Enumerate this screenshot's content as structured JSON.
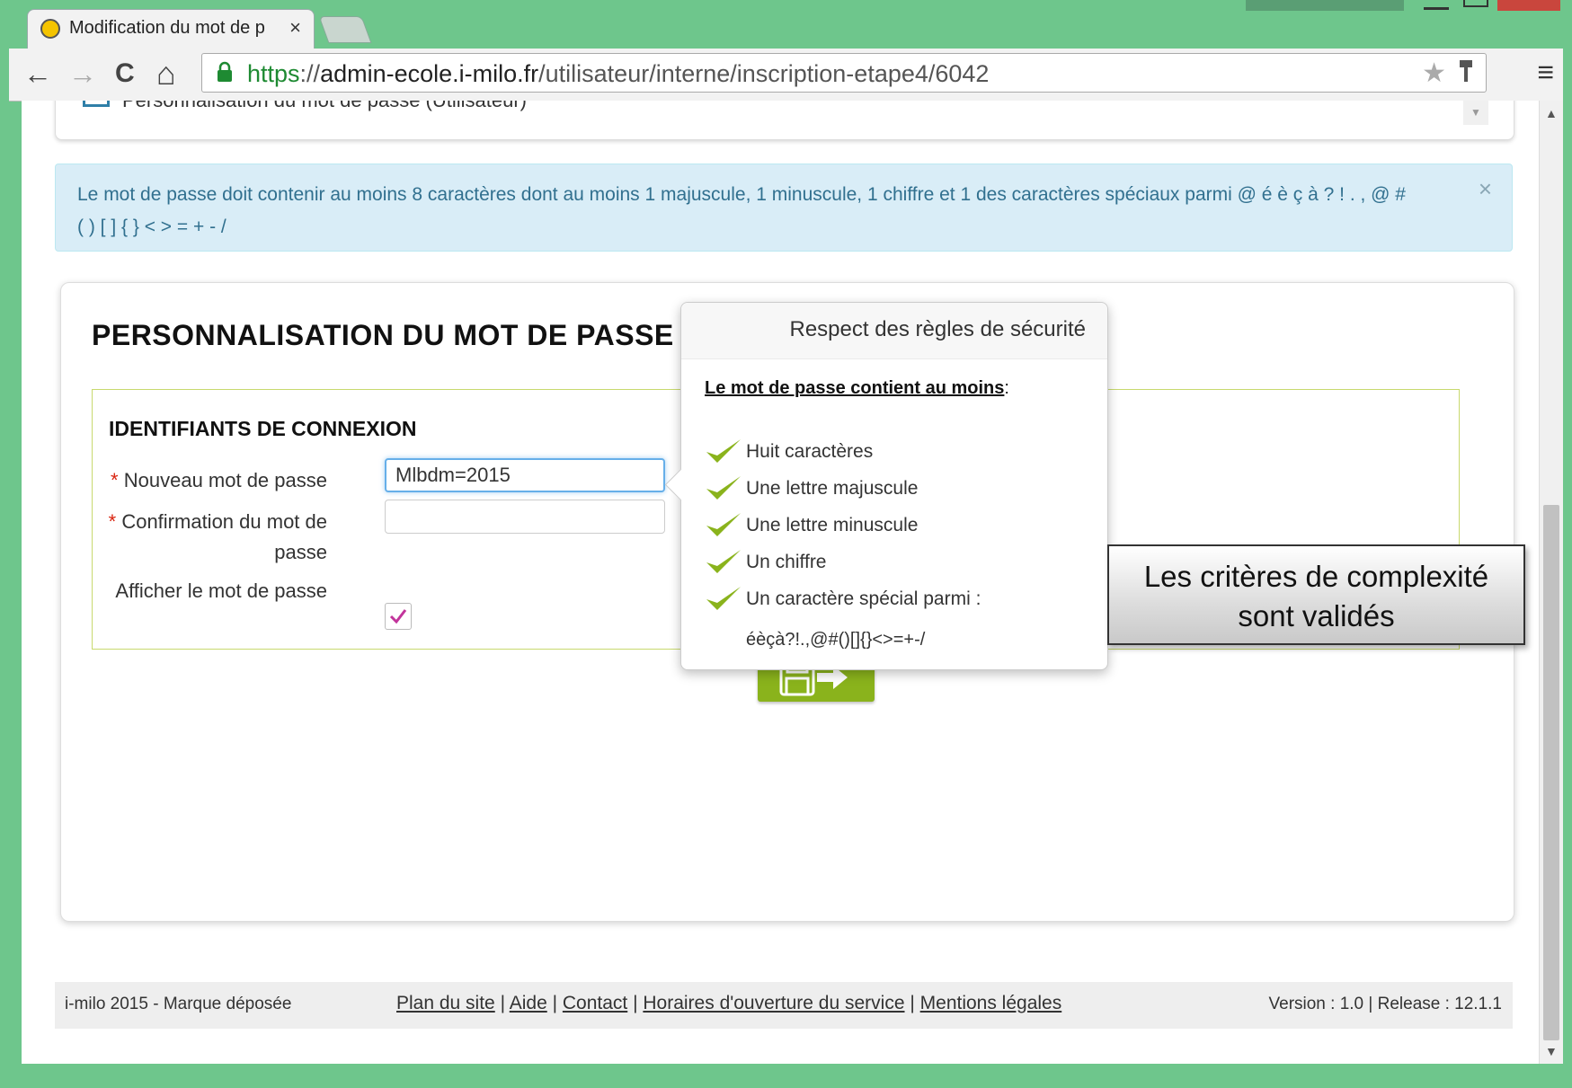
{
  "browser": {
    "tab_title": "Modification du mot de p",
    "tab_close": "×",
    "url_scheme": "https",
    "url_separator": "://",
    "url_host": "admin-ecole.i-milo.fr",
    "url_path": "/utilisateur/interne/inscription-etape4/6042",
    "back_glyph": "←",
    "forward_glyph": "→",
    "reload_glyph": "C",
    "home_glyph": "⌂",
    "star_glyph": "★",
    "menu_glyph": "≡"
  },
  "top_card": {
    "text": "Personnalisation du mot de passe (Utilisateur)"
  },
  "alert": {
    "text": "Le mot de passe doit contenir au moins 8 caractères dont au moins 1 majuscule, 1 minuscule, 1 chiffre et 1 des caractères spéciaux parmi @ é è ç à ? ! . , @ # ( ) [ ] { } < > = + - /",
    "close": "×"
  },
  "form": {
    "title": "PERSONNALISATION DU MOT DE PASSE",
    "section_title": "IDENTIFIANTS DE CONNEXION",
    "required_marker": "*",
    "new_password_label": "Nouveau mot de passe",
    "new_password_value": "Mlbdm=2015",
    "confirm_label_1": "Confirmation du mot de",
    "confirm_label_2": "passe",
    "confirm_value": "",
    "show_password_label": "Afficher le mot de passe",
    "show_password_checked": true
  },
  "popover": {
    "title": "Respect des règles de sécurité",
    "subtitle": "Le mot de passe contient au moins",
    "subtitle_suffix": ":",
    "criteria": [
      "Huit caractères",
      "Une lettre majuscule",
      "Une lettre minuscule",
      "Un chiffre",
      "Un caractère spécial parmi :"
    ],
    "special_chars": "éèçà?!.,@#()[]{}<>=+-/"
  },
  "callout": {
    "line1": "Les critères de complexité",
    "line2": "sont validés"
  },
  "footer": {
    "left": "i-milo 2015 - Marque déposée",
    "links": [
      "Plan du site",
      "Aide",
      "Contact",
      "Horaires d'ouverture du service",
      "Mentions légales"
    ],
    "separator": " | ",
    "right": "Version : 1.0 | Release : 12.1.1"
  },
  "colors": {
    "window_frame": "#6ec68c",
    "accent_green": "#8ab31c",
    "check_green": "#8ab31c",
    "alert_bg": "#d9edf7",
    "alert_text": "#31708f",
    "required": "#d9230f"
  }
}
